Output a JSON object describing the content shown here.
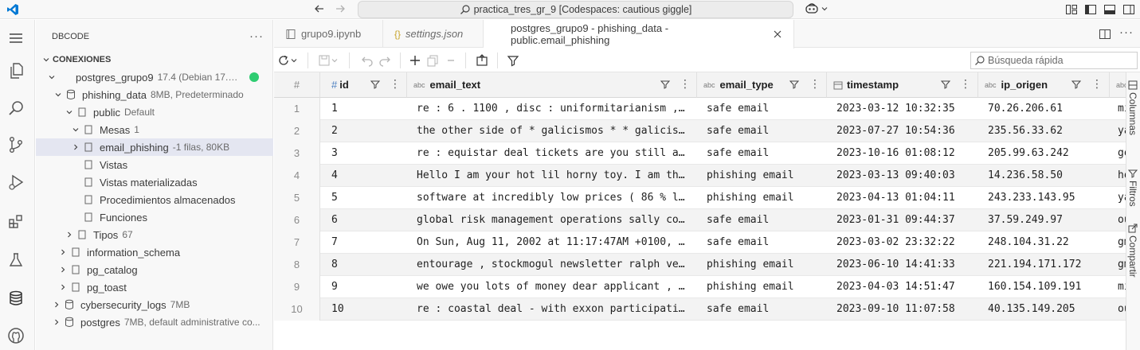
{
  "titlebar": {
    "command_center": "practica_tres_gr_9 [Codespaces: cautious giggle]"
  },
  "sidebar": {
    "title": "DBCODE",
    "more": "···",
    "connections_header": "CONEXIONES",
    "tree": [
      {
        "label": "postgres_grupo9",
        "meta": "17.4 (Debian 17.4-..."
      },
      {
        "label": "phishing_data",
        "meta": "8MB, Predeterminado"
      },
      {
        "label": "public",
        "meta": "Default"
      },
      {
        "label": "Mesas",
        "meta": "1"
      },
      {
        "label": "email_phishing",
        "meta": "-1 filas, 80KB"
      },
      {
        "label": "Vistas",
        "meta": ""
      },
      {
        "label": "Vistas materializadas",
        "meta": ""
      },
      {
        "label": "Procedimientos almacenados",
        "meta": ""
      },
      {
        "label": "Funciones",
        "meta": ""
      },
      {
        "label": "Tipos",
        "meta": "67"
      },
      {
        "label": "information_schema",
        "meta": ""
      },
      {
        "label": "pg_catalog",
        "meta": ""
      },
      {
        "label": "pg_toast",
        "meta": ""
      },
      {
        "label": "cybersecurity_logs",
        "meta": "7MB"
      },
      {
        "label": "postgres",
        "meta": "7MB, default administrative co..."
      }
    ]
  },
  "tabs": [
    {
      "label": "grupo9.ipynb"
    },
    {
      "label": "settings.json"
    },
    {
      "label": "postgres_grupo9 - phishing_data - public.email_phishing"
    }
  ],
  "toolbar": {
    "search_placeholder": "Búsqueda rápida"
  },
  "grid": {
    "rownum_header": "#",
    "columns": [
      {
        "name": "id",
        "type_badge": "#"
      },
      {
        "name": "email_text",
        "type_badge": "abc"
      },
      {
        "name": "email_type",
        "type_badge": "abc"
      },
      {
        "name": "timestamp",
        "type_badge": ""
      },
      {
        "name": "ip_origen",
        "type_badge": "abc"
      },
      {
        "name": "",
        "type_badge": "abc"
      }
    ],
    "rows": [
      {
        "num": "1",
        "id": "1",
        "email_text": "re : 6 . 1100 , disc : uniformitarianism , ...",
        "email_type": "safe email",
        "timestamp": "2023-03-12 10:32:35",
        "ip_origen": "70.26.206.61",
        "next": "mi"
      },
      {
        "num": "2",
        "id": "2",
        "email_text": "the other side of * galicismos * * galicism...",
        "email_type": "safe email",
        "timestamp": "2023-07-27 10:54:36",
        "ip_origen": "235.56.33.62",
        "next": "ya"
      },
      {
        "num": "3",
        "id": "3",
        "email_text": "re : equistar deal tickets are you still av...",
        "email_type": "safe email",
        "timestamp": "2023-10-16 01:08:12",
        "ip_origen": "205.99.63.242",
        "next": "go"
      },
      {
        "num": "4",
        "id": "4",
        "email_text": "Hello I am your hot lil horny toy. I am the...",
        "email_type": "phishing email",
        "timestamp": "2023-03-13 09:40:03",
        "ip_origen": "14.236.58.50",
        "next": "ho"
      },
      {
        "num": "5",
        "id": "5",
        "email_text": "software at incredibly low prices ( 86 % lo...",
        "email_type": "phishing email",
        "timestamp": "2023-04-13 01:04:11",
        "ip_origen": "243.233.143.95",
        "next": "ya"
      },
      {
        "num": "6",
        "id": "6",
        "email_text": "global risk management operations sally con...",
        "email_type": "safe email",
        "timestamp": "2023-01-31 09:44:37",
        "ip_origen": "37.59.249.97",
        "next": "ou"
      },
      {
        "num": "7",
        "id": "7",
        "email_text": "On Sun, Aug 11, 2002 at 11:17:47AM +0100, w...",
        "email_type": "safe email",
        "timestamp": "2023-03-02 23:32:22",
        "ip_origen": "248.104.31.22",
        "next": "gm"
      },
      {
        "num": "8",
        "id": "8",
        "email_text": "entourage , stockmogul newsletter ralph vel...",
        "email_type": "phishing email",
        "timestamp": "2023-06-10 14:41:33",
        "ip_origen": "221.194.171.172",
        "next": "gm"
      },
      {
        "num": "9",
        "id": "9",
        "email_text": "we owe you lots of money dear applicant , a...",
        "email_type": "phishing email",
        "timestamp": "2023-04-03 14:51:47",
        "ip_origen": "160.154.109.191",
        "next": "mi"
      },
      {
        "num": "10",
        "id": "10",
        "email_text": "re : coastal deal - with exxon participatio...",
        "email_type": "safe email",
        "timestamp": "2023-09-10 11:07:58",
        "ip_origen": "40.135.149.205",
        "next": "ou"
      }
    ]
  },
  "sidepanel": {
    "columns_label": "Columnas",
    "filters_label": "Filtros",
    "share_label": "Compartir"
  },
  "colors": {
    "accent": "#007acc",
    "status_connected": "#2ecc71",
    "selected_row": "#e4e6f1"
  }
}
